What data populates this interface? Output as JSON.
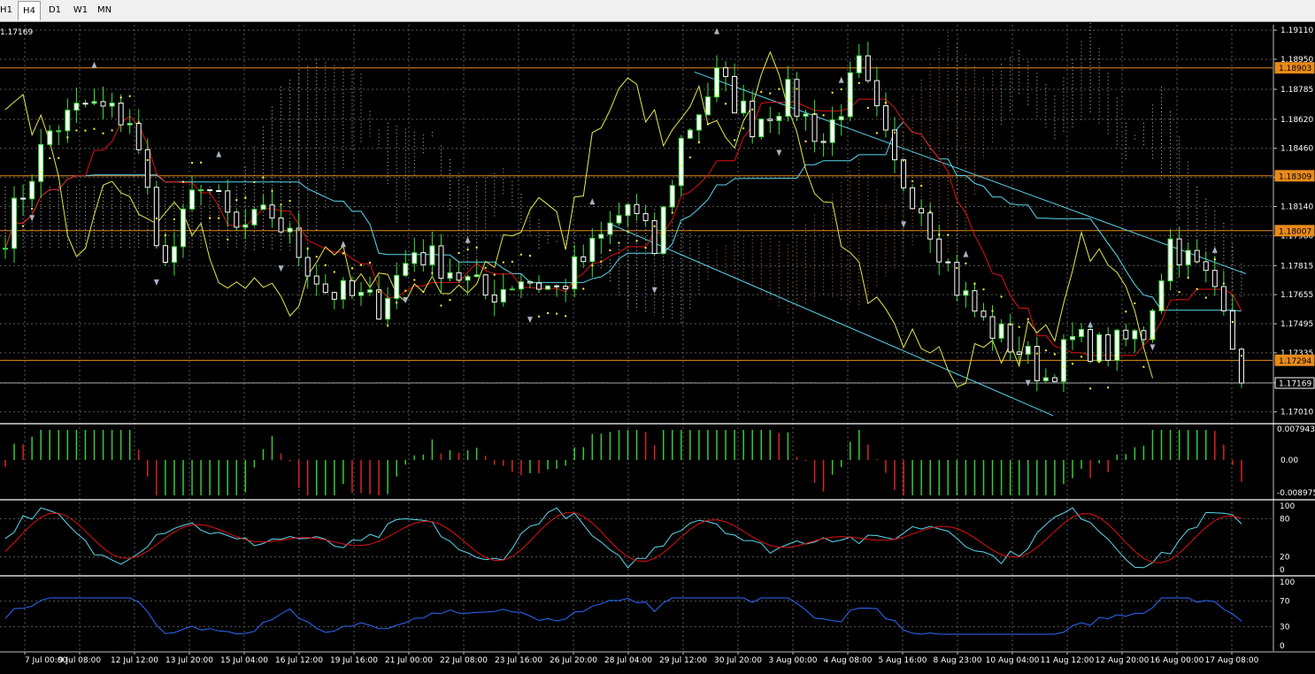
{
  "toolbar": {
    "timeframes": [
      "H1",
      "H4",
      "D1",
      "W1",
      "MN"
    ],
    "active": "H4"
  },
  "symbol_price": "1.17169",
  "colors": {
    "background": "#000000",
    "grid": "#5a5a5a",
    "text": "#ffffff",
    "bull_candle": "#ffffff",
    "bear_candle": "#ffffff",
    "wick": "#3ee03e",
    "kijun": "#5ad8ee",
    "tenkan": "#e01010",
    "chikou": "#e8e84a",
    "cloud": "#ffffff",
    "cloud_bear": "#ff9a4a",
    "sar": "#ffff33",
    "hline": "#e88a1a",
    "trend": "#5ad8ee",
    "fractal": "#a8b4c4",
    "macd_up": "#33cc33",
    "macd_down": "#dd2222",
    "stoch_main": "#5ad8ee",
    "stoch_signal": "#e01010",
    "rsi": "#2a6cff"
  },
  "chart_data": [
    {
      "panel": "price",
      "type": "candlestick",
      "ylim": [
        1.1695,
        1.1914
      ],
      "price_ticks": [
        "1.19110",
        "1.18950",
        "1.18785",
        "1.18620",
        "1.18460",
        "1.18300",
        "1.18140",
        "1.17980",
        "1.17815",
        "1.17655",
        "1.17495",
        "1.17335",
        "1.17170",
        "1.17010"
      ],
      "levels": [
        {
          "label": "1.18903",
          "value": 1.18903,
          "kind": "horizontal-line"
        },
        {
          "label": "1.18309",
          "value": 1.18309,
          "kind": "horizontal-line"
        },
        {
          "label": "1.18007",
          "value": 1.18007,
          "kind": "horizontal-line"
        },
        {
          "label": "1.17294",
          "value": 1.17294,
          "kind": "horizontal-line"
        },
        {
          "label": "1.17169",
          "value": 1.17169,
          "kind": "current-price"
        }
      ],
      "trendlines": [
        {
          "from": [
            25,
            1.1888
          ],
          "to": [
            45,
            1.1777
          ]
        },
        {
          "from": [
            22,
            1.1804
          ],
          "to": [
            38,
            1.1699
          ]
        }
      ]
    },
    {
      "panel": "macd",
      "type": "bar",
      "ticks": [
        "0.007943",
        "0.00",
        "-0.008975"
      ],
      "ylim": [
        -0.008975,
        0.007943
      ]
    },
    {
      "panel": "stochastic",
      "type": "line",
      "ticks": [
        "100",
        "80",
        "20",
        "0"
      ],
      "ylim": [
        0,
        100
      ]
    },
    {
      "panel": "rsi",
      "type": "line",
      "ticks": [
        "100",
        "70",
        "30",
        "0"
      ],
      "ylim": [
        0,
        100
      ]
    }
  ],
  "time_labels": [
    "7 Jul 00:00",
    "9 Jul 08:00",
    "12 Jul 12:00",
    "13 Jul 20:00",
    "15 Jul 04:00",
    "16 Jul 12:00",
    "19 Jul 16:00",
    "21 Jul 00:00",
    "22 Jul 08:00",
    "23 Jul 16:00",
    "26 Jul 20:00",
    "28 Jul 04:00",
    "29 Jul 12:00",
    "30 Jul 20:00",
    "3 Aug 00:00",
    "4 Aug 08:00",
    "5 Aug 16:00",
    "8 Aug 23:00",
    "10 Aug 04:00",
    "11 Aug 12:00",
    "12 Aug 20:00",
    "16 Aug 00:00",
    "17 Aug 08:00"
  ]
}
